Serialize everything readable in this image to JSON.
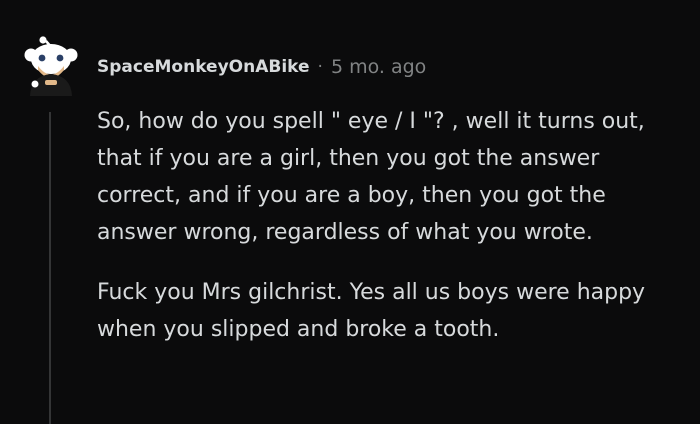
{
  "comment": {
    "author": "SpaceMonkeyOnABike",
    "separator": "·",
    "time_ago": "5 mo. ago",
    "avatar_icon": "snoo-avatar-icon",
    "paragraphs": [
      "So, how do you spell \" eye / I \"? , well it turns out, that if you are a girl, then you got the answer correct, and if you are a boy, then you got the answer wrong, regardless of what you wrote.",
      "Fuck you Mrs gilchrist. Yes all us boys were happy when you slipped and broke a tooth."
    ]
  },
  "colors": {
    "background": "#0b0b0c",
    "text": "#d7dadc",
    "meta": "#818384",
    "thread_line": "#343536"
  }
}
